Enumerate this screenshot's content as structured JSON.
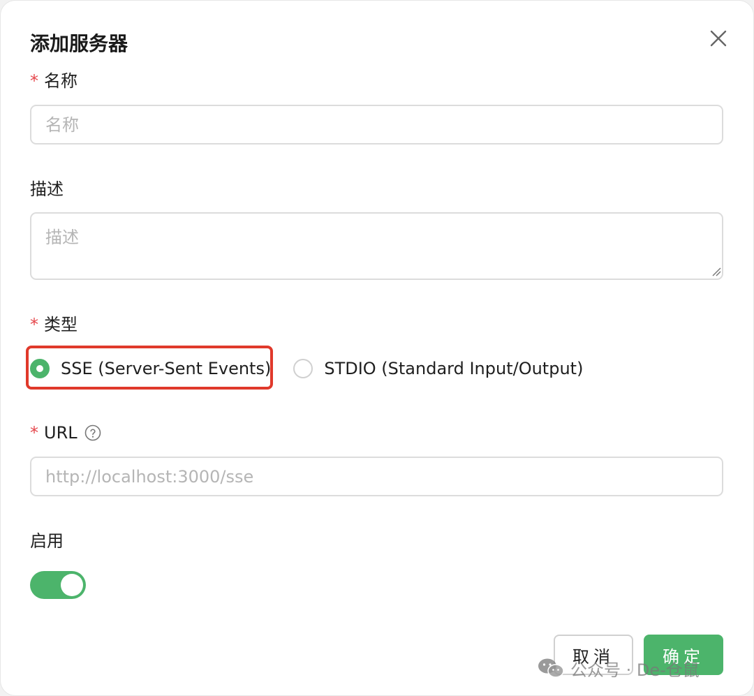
{
  "dialog": {
    "title": "添加服务器",
    "close_icon": "close-icon"
  },
  "form": {
    "name": {
      "required_mark": "*",
      "label": "名称",
      "placeholder": "名称",
      "value": ""
    },
    "description": {
      "label": "描述",
      "placeholder": "描述",
      "value": ""
    },
    "type": {
      "required_mark": "*",
      "label": "类型",
      "options": [
        {
          "label": "SSE (Server-Sent Events)",
          "selected": true
        },
        {
          "label": "STDIO (Standard Input/Output)",
          "selected": false
        }
      ]
    },
    "url": {
      "required_mark": "*",
      "label": "URL",
      "help_icon": "question-circle-icon",
      "placeholder": "http://localhost:3000/sse",
      "value": ""
    },
    "enabled": {
      "label": "启用",
      "on": true
    }
  },
  "actions": {
    "cancel_label": "取消",
    "confirm_label": "确定"
  },
  "watermark": {
    "text": "公众号 · De-仓鼠",
    "icon": "wechat-icon"
  },
  "colors": {
    "accent": "#4cb46b",
    "required": "#e5484d",
    "highlight": "#e0392b"
  }
}
